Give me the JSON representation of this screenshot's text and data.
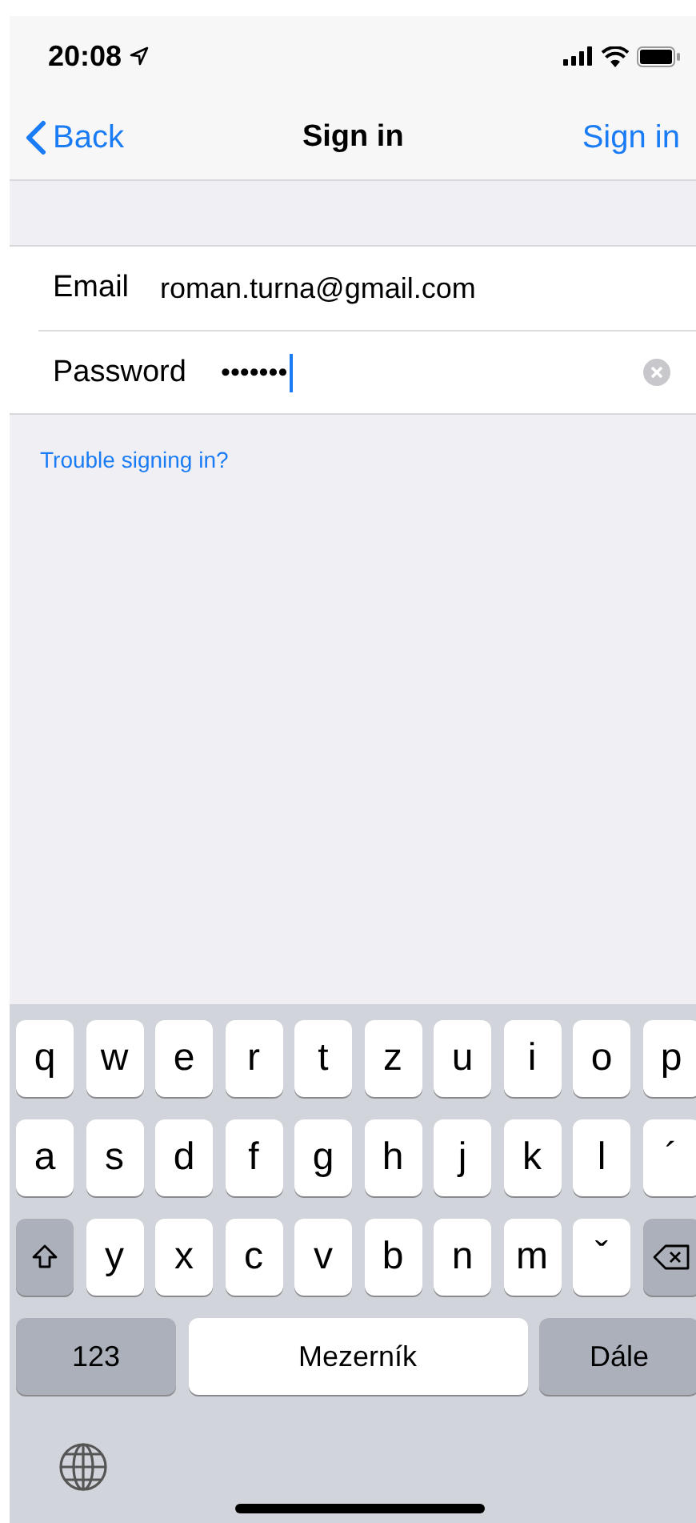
{
  "status_bar": {
    "time": "20:08"
  },
  "nav": {
    "back": "Back",
    "title": "Sign in",
    "action": "Sign in"
  },
  "fields": [
    {
      "label": "Email",
      "value": "roman.turna@gmail.com",
      "focused": false,
      "clearable": false
    },
    {
      "label": "Password",
      "value": "•••••••",
      "focused": true,
      "clearable": true
    }
  ],
  "link": "Trouble signing in?",
  "keyboard": {
    "letter_rows": [
      [
        {
          "kind": "letter",
          "label": "q"
        },
        {
          "kind": "letter",
          "label": "w"
        },
        {
          "kind": "letter",
          "label": "e"
        },
        {
          "kind": "letter",
          "label": "r"
        },
        {
          "kind": "letter",
          "label": "t"
        },
        {
          "kind": "letter",
          "label": "z"
        },
        {
          "kind": "letter",
          "label": "u"
        },
        {
          "kind": "letter",
          "label": "i"
        },
        {
          "kind": "letter",
          "label": "o"
        },
        {
          "kind": "letter",
          "label": "p"
        }
      ],
      [
        {
          "kind": "letter",
          "label": "a"
        },
        {
          "kind": "letter",
          "label": "s"
        },
        {
          "kind": "letter",
          "label": "d"
        },
        {
          "kind": "letter",
          "label": "f"
        },
        {
          "kind": "letter",
          "label": "g"
        },
        {
          "kind": "letter",
          "label": "h"
        },
        {
          "kind": "letter",
          "label": "j"
        },
        {
          "kind": "letter",
          "label": "k"
        },
        {
          "kind": "letter",
          "label": "l"
        },
        {
          "kind": "letter",
          "label": "´"
        }
      ],
      [
        {
          "kind": "shift"
        },
        {
          "kind": "letter",
          "label": "y"
        },
        {
          "kind": "letter",
          "label": "x"
        },
        {
          "kind": "letter",
          "label": "c"
        },
        {
          "kind": "letter",
          "label": "v"
        },
        {
          "kind": "letter",
          "label": "b"
        },
        {
          "kind": "letter",
          "label": "n"
        },
        {
          "kind": "letter",
          "label": "m"
        },
        {
          "kind": "letter",
          "label": "ˇ"
        },
        {
          "kind": "backspace"
        }
      ]
    ],
    "bottom_keys": [
      {
        "kind": "numbers",
        "label": "123"
      },
      {
        "kind": "space",
        "label": "Mezerník"
      },
      {
        "kind": "return",
        "label": "Dále"
      }
    ]
  }
}
